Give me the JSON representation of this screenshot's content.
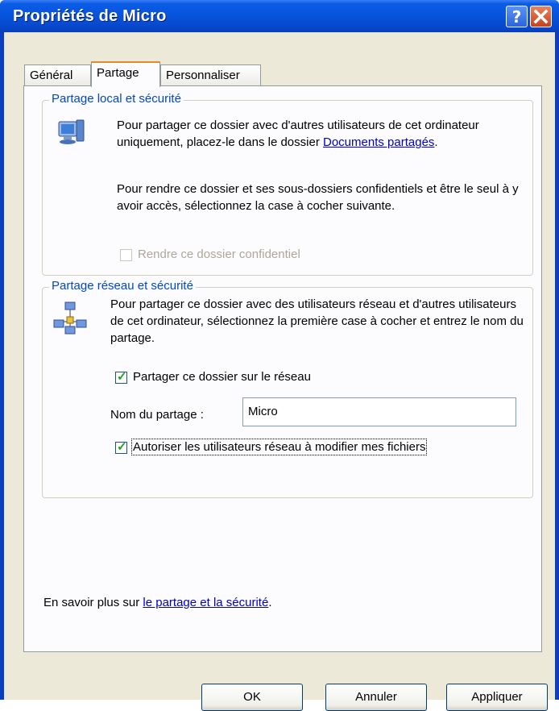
{
  "window": {
    "title": "Propriétés de Micro"
  },
  "tabs": [
    {
      "label": "Général"
    },
    {
      "label": "Partage"
    },
    {
      "label": "Personnaliser"
    }
  ],
  "local_group": {
    "title": "Partage local et sécurité",
    "text1": "Pour partager ce dossier avec d'autres utilisateurs de cet ordinateur uniquement, placez-le dans le dossier",
    "link": "Documents partagés",
    "text1_end": ".",
    "text2": "Pour rendre ce dossier et ses sous-dossiers confidentiels et être le seul à y avoir accès, sélectionnez la case à cocher suivante.",
    "private_checkbox_label": "Rendre ce dossier confidentiel"
  },
  "network_group": {
    "title": "Partage réseau et sécurité",
    "text": "Pour partager ce dossier avec des utilisateurs réseau et d'autres utilisateurs de cet ordinateur, sélectionnez la première case à cocher et entrez le nom du partage.",
    "share_checkbox_label": "Partager ce dossier sur le réseau",
    "share_name_label": "Nom du partage :",
    "share_name_value": "Micro",
    "modify_checkbox_label": "Autoriser les utilisateurs réseau à modifier mes fichiers"
  },
  "footer": {
    "learn_more_text": "En savoir plus sur",
    "learn_more_link": "le partage et la sécurité",
    "learn_more_end": "."
  },
  "buttons": {
    "ok": "OK",
    "cancel": "Annuler",
    "apply": "Appliquer"
  },
  "icons": {
    "help": "help-icon",
    "close": "close-icon",
    "local": "computer-icon",
    "network": "network-icon"
  },
  "colors": {
    "titlebar": "#0853dc",
    "group_title": "#0046d5",
    "link": "#0000c8",
    "checkmark": "#21a121"
  }
}
